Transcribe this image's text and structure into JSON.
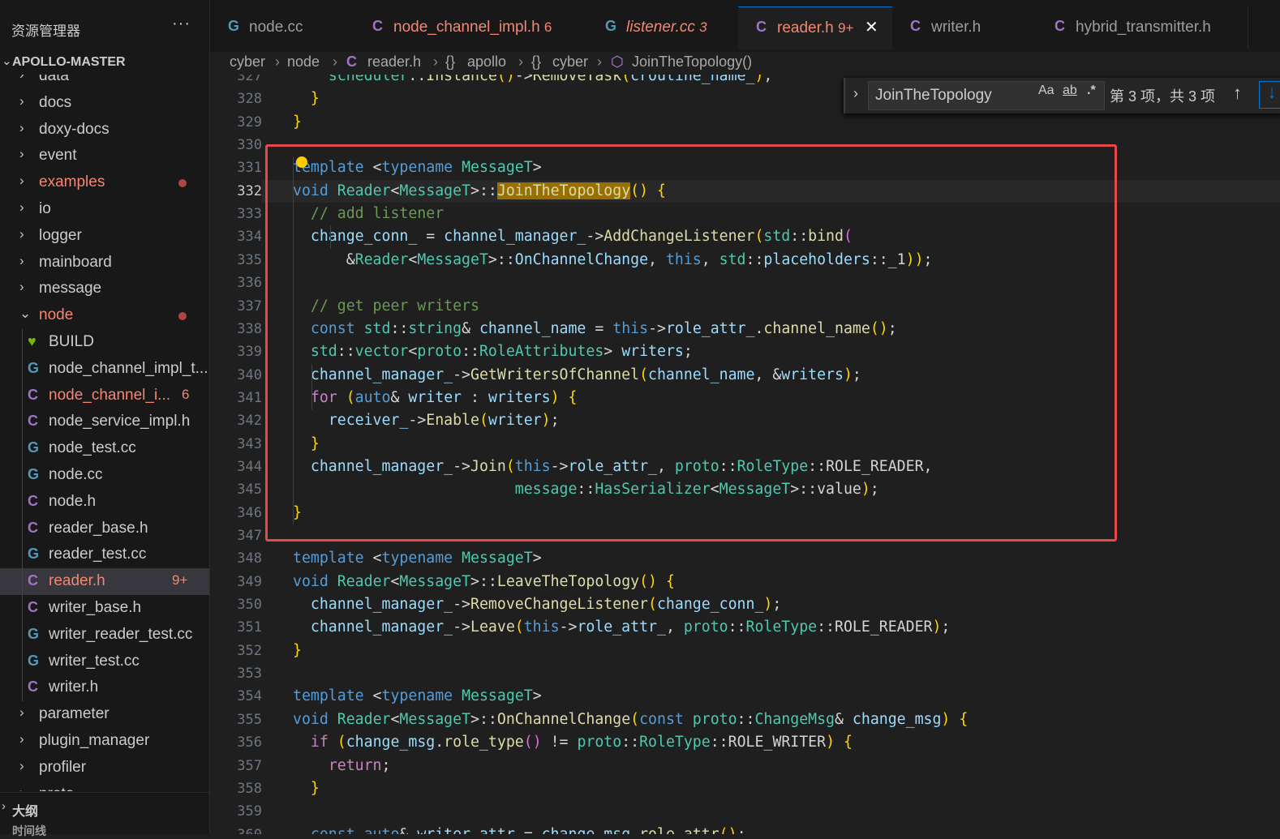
{
  "explorer": {
    "title": "资源管理器",
    "more": "···",
    "root": "APOLLO-MASTER",
    "items": [
      {
        "label": "data",
        "kind": "folder"
      },
      {
        "label": "docs",
        "kind": "folder"
      },
      {
        "label": "doxy-docs",
        "kind": "folder"
      },
      {
        "label": "event",
        "kind": "folder"
      },
      {
        "label": "examples",
        "kind": "folder",
        "modified": true
      },
      {
        "label": "io",
        "kind": "folder"
      },
      {
        "label": "logger",
        "kind": "folder"
      },
      {
        "label": "mainboard",
        "kind": "folder"
      },
      {
        "label": "message",
        "kind": "folder"
      },
      {
        "label": "node",
        "kind": "folder-open",
        "modified": true
      },
      {
        "label": "BUILD",
        "kind": "bazel"
      },
      {
        "label": "node_channel_impl_t...",
        "kind": "cpp"
      },
      {
        "label": "node_channel_i...",
        "kind": "c",
        "badge": "6",
        "modified": true
      },
      {
        "label": "node_service_impl.h",
        "kind": "c"
      },
      {
        "label": "node_test.cc",
        "kind": "cpp"
      },
      {
        "label": "node.cc",
        "kind": "cpp"
      },
      {
        "label": "node.h",
        "kind": "c"
      },
      {
        "label": "reader_base.h",
        "kind": "c"
      },
      {
        "label": "reader_test.cc",
        "kind": "cpp"
      },
      {
        "label": "reader.h",
        "kind": "c",
        "badge": "9+",
        "modified": true,
        "selected": true
      },
      {
        "label": "writer_base.h",
        "kind": "c"
      },
      {
        "label": "writer_reader_test.cc",
        "kind": "cpp"
      },
      {
        "label": "writer_test.cc",
        "kind": "cpp"
      },
      {
        "label": "writer.h",
        "kind": "c"
      },
      {
        "label": "parameter",
        "kind": "folder"
      },
      {
        "label": "plugin_manager",
        "kind": "folder"
      },
      {
        "label": "profiler",
        "kind": "folder"
      },
      {
        "label": "proto",
        "kind": "folder"
      }
    ],
    "outline": "大纲",
    "timeline": "时间线"
  },
  "tabs": [
    {
      "label": "node.cc",
      "icon": "cpp"
    },
    {
      "label": "node_channel_impl.h",
      "badge": "6",
      "icon": "c",
      "modified": true
    },
    {
      "label": "listener.cc",
      "badge": "3",
      "icon": "cpp",
      "modified": true,
      "italic": true
    },
    {
      "label": "reader.h",
      "badge": "9+",
      "icon": "c",
      "active": true,
      "modified": true
    },
    {
      "label": "writer.h",
      "icon": "c"
    },
    {
      "label": "hybrid_transmitter.h",
      "icon": "c"
    }
  ],
  "breadcrumb": [
    "cyber",
    "node",
    "reader.h",
    "apollo",
    "cyber",
    "JoinTheTopology()"
  ],
  "find": {
    "query": "JoinTheTopology",
    "match_case": "Aa",
    "whole_word": "ab",
    "regex": ".*",
    "result": "第 3 项，共 3 项"
  },
  "editor": {
    "active_line": 332,
    "lines": [
      {
        "n": 327,
        "text": "    scheduler::Instance()->RemoveTask(croutine_name_);"
      },
      {
        "n": 328,
        "text": "  }"
      },
      {
        "n": 329,
        "text": "}"
      },
      {
        "n": 330,
        "text": ""
      },
      {
        "n": 331,
        "text": "template <typename MessageT>"
      },
      {
        "n": 332,
        "text": "void Reader<MessageT>::JoinTheTopology() {"
      },
      {
        "n": 333,
        "text": "  // add listener"
      },
      {
        "n": 334,
        "text": "  change_conn_ = channel_manager_->AddChangeListener(std::bind("
      },
      {
        "n": 335,
        "text": "      &Reader<MessageT>::OnChannelChange, this, std::placeholders::_1));"
      },
      {
        "n": 336,
        "text": ""
      },
      {
        "n": 337,
        "text": "  // get peer writers"
      },
      {
        "n": 338,
        "text": "  const std::string& channel_name = this->role_attr_.channel_name();"
      },
      {
        "n": 339,
        "text": "  std::vector<proto::RoleAttributes> writers;"
      },
      {
        "n": 340,
        "text": "  channel_manager_->GetWritersOfChannel(channel_name, &writers);"
      },
      {
        "n": 341,
        "text": "  for (auto& writer : writers) {"
      },
      {
        "n": 342,
        "text": "    receiver_->Enable(writer);"
      },
      {
        "n": 343,
        "text": "  }"
      },
      {
        "n": 344,
        "text": "  channel_manager_->Join(this->role_attr_, proto::RoleType::ROLE_READER,"
      },
      {
        "n": 345,
        "text": "                         message::HasSerializer<MessageT>::value);"
      },
      {
        "n": 346,
        "text": "}"
      },
      {
        "n": 347,
        "text": ""
      },
      {
        "n": 348,
        "text": "template <typename MessageT>"
      },
      {
        "n": 349,
        "text": "void Reader<MessageT>::LeaveTheTopology() {"
      },
      {
        "n": 350,
        "text": "  channel_manager_->RemoveChangeListener(change_conn_);"
      },
      {
        "n": 351,
        "text": "  channel_manager_->Leave(this->role_attr_, proto::RoleType::ROLE_READER);"
      },
      {
        "n": 352,
        "text": "}"
      },
      {
        "n": 353,
        "text": ""
      },
      {
        "n": 354,
        "text": "template <typename MessageT>"
      },
      {
        "n": 355,
        "text": "void Reader<MessageT>::OnChannelChange(const proto::ChangeMsg& change_msg) {"
      },
      {
        "n": 356,
        "text": "  if (change_msg.role_type() != proto::RoleType::ROLE_WRITER) {"
      },
      {
        "n": 357,
        "text": "    return;"
      },
      {
        "n": 358,
        "text": "  }"
      },
      {
        "n": 359,
        "text": ""
      },
      {
        "n": 360,
        "text": "  const auto& writer_attr = change_msg.role_attr();"
      }
    ]
  },
  "colors": {
    "accent": "#0078d4",
    "highlight_box": "#e8474c",
    "modified": "#f48771",
    "find_match": "#996f00"
  }
}
